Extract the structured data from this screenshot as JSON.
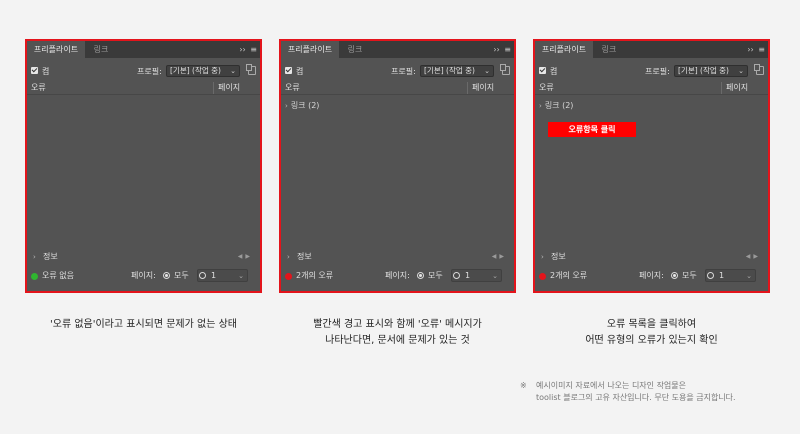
{
  "panel_common": {
    "tab_active": "프리플라이트",
    "tab_link": "링크",
    "menu_arrows": "››",
    "menu_icon": "≡",
    "on_label": "켬",
    "profile_label": "프로필:",
    "profile_value": "[기본] (작업 중)",
    "col_error": "오류",
    "col_page": "페이지",
    "info_label": "정보",
    "page_label": "페이지:",
    "all_label": "모두",
    "one_label": "1"
  },
  "panels": [
    {
      "status_text": "오류 없음",
      "status_color": "#2fb52f",
      "list_item": ""
    },
    {
      "status_text": "2개의 오류",
      "status_color": "#e3141b",
      "list_item": "링크 (2)"
    },
    {
      "status_text": "2개의 오류",
      "status_color": "#e3141b",
      "list_item": "링크 (2)",
      "callout": "오류항목 클릭"
    }
  ],
  "captions": {
    "cap1_line1": "'오류 없음'이라고 표시되면 문제가 없는 상태",
    "cap2_line1": "빨간색 경고 표시와 함께 '오류' 메시지가",
    "cap2_line2": "나타난다면, 문서에 문제가 있는 것",
    "cap3_line1": "오류 목록을 클릭하여",
    "cap3_line2": "어떤 유형의 오류가 있는지 확인"
  },
  "note": {
    "mark": "※",
    "line1": "예시이미지 자료에서 나오는 디자인 작업물은",
    "line2": "toolist 블로그의 고유 자산입니다. 무단 도용을 금지합니다."
  },
  "colors": {
    "accent_red": "#e3141b",
    "ok_green": "#2fb52f",
    "panel_bg": "#535353"
  }
}
